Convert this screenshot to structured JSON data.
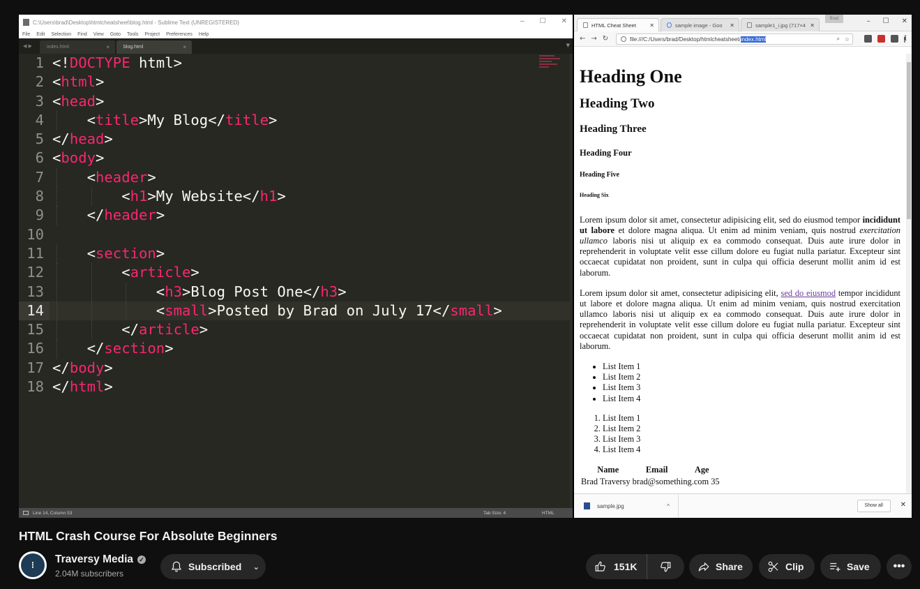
{
  "sublime": {
    "title": "C:\\Users\\brad\\Desktop\\htmlcheatsheet\\blog.html - Sublime Text (UNREGISTERED)",
    "window_controls": [
      "–",
      "☐",
      "✕"
    ],
    "menu": [
      "File",
      "Edit",
      "Selection",
      "Find",
      "View",
      "Goto",
      "Tools",
      "Project",
      "Preferences",
      "Help"
    ],
    "tabs": [
      {
        "label": "index.html",
        "active": false
      },
      {
        "label": "blog.html",
        "active": true
      }
    ],
    "code_lines": [
      {
        "n": "1",
        "segs": [
          [
            "t",
            "<!"
          ],
          [
            "g",
            "DOCTYPE"
          ],
          [
            "t",
            " html>"
          ]
        ]
      },
      {
        "n": "2",
        "segs": [
          [
            "t",
            "<"
          ],
          [
            "g",
            "html"
          ],
          [
            "t",
            ">"
          ]
        ]
      },
      {
        "n": "3",
        "segs": [
          [
            "t",
            "<"
          ],
          [
            "g",
            "head"
          ],
          [
            "t",
            ">"
          ]
        ]
      },
      {
        "n": "4",
        "segs": [
          [
            "t",
            "    <"
          ],
          [
            "g",
            "title"
          ],
          [
            "t",
            ">My Blog</"
          ],
          [
            "g",
            "title"
          ],
          [
            "t",
            ">"
          ]
        ]
      },
      {
        "n": "5",
        "segs": [
          [
            "t",
            "</"
          ],
          [
            "g",
            "head"
          ],
          [
            "t",
            ">"
          ]
        ]
      },
      {
        "n": "6",
        "segs": [
          [
            "t",
            "<"
          ],
          [
            "g",
            "body"
          ],
          [
            "t",
            ">"
          ]
        ]
      },
      {
        "n": "7",
        "segs": [
          [
            "t",
            "    <"
          ],
          [
            "g",
            "header"
          ],
          [
            "t",
            ">"
          ]
        ]
      },
      {
        "n": "8",
        "segs": [
          [
            "t",
            "        <"
          ],
          [
            "g",
            "h1"
          ],
          [
            "t",
            ">My Website</"
          ],
          [
            "g",
            "h1"
          ],
          [
            "t",
            ">"
          ]
        ]
      },
      {
        "n": "9",
        "segs": [
          [
            "t",
            "    </"
          ],
          [
            "g",
            "header"
          ],
          [
            "t",
            ">"
          ]
        ]
      },
      {
        "n": "10",
        "segs": []
      },
      {
        "n": "11",
        "segs": [
          [
            "t",
            "    <"
          ],
          [
            "g",
            "section"
          ],
          [
            "t",
            ">"
          ]
        ]
      },
      {
        "n": "12",
        "segs": [
          [
            "t",
            "        <"
          ],
          [
            "g",
            "article"
          ],
          [
            "t",
            ">"
          ]
        ]
      },
      {
        "n": "13",
        "segs": [
          [
            "t",
            "            <"
          ],
          [
            "g",
            "h3"
          ],
          [
            "t",
            ">Blog Post One</"
          ],
          [
            "g",
            "h3"
          ],
          [
            "t",
            ">"
          ]
        ]
      },
      {
        "n": "14",
        "segs": [
          [
            "t",
            "            <"
          ],
          [
            "g",
            "small"
          ],
          [
            "t",
            ">Posted by Brad on July 17</"
          ],
          [
            "g",
            "small"
          ],
          [
            "t",
            ">"
          ]
        ],
        "current": true
      },
      {
        "n": "15",
        "segs": [
          [
            "t",
            "        </"
          ],
          [
            "g",
            "article"
          ],
          [
            "t",
            ">"
          ]
        ]
      },
      {
        "n": "16",
        "segs": [
          [
            "t",
            "    </"
          ],
          [
            "g",
            "section"
          ],
          [
            "t",
            ">"
          ]
        ]
      },
      {
        "n": "17",
        "segs": [
          [
            "t",
            "</"
          ],
          [
            "g",
            "body"
          ],
          [
            "t",
            ">"
          ]
        ]
      },
      {
        "n": "18",
        "segs": [
          [
            "t",
            "</"
          ],
          [
            "g",
            "html"
          ],
          [
            "t",
            ">"
          ]
        ]
      }
    ],
    "status": {
      "position": "Line 14, Column 53",
      "tab_size": "Tab Size: 4",
      "syntax": "HTML"
    }
  },
  "chrome": {
    "profile_badge": "Brad",
    "tabs": [
      {
        "label": "HTML Cheat Sheet",
        "active": true
      },
      {
        "label": "sample image - Goo",
        "active": false
      },
      {
        "label": "sample1_i.jpg (717×4",
        "active": false
      }
    ],
    "url_prefix": "file:///C:/Users/brad/Desktop/htmlcheatsheet/",
    "url_selected": "index.html",
    "page": {
      "h1": "Heading One",
      "h2": "Heading Two",
      "h3": "Heading Three",
      "h4": "Heading Four",
      "h5": "Heading Five",
      "h6": "Heading Six",
      "p1_a": "Lorem ipsum dolor sit amet, consectetur adipisicing elit, sed do eiusmod tempor ",
      "p1_bold": "incididunt ut labore",
      "p1_b": " et dolore magna aliqua. Ut enim ad minim veniam, quis nostrud ",
      "p1_italic": "exercitation ullamco",
      "p1_c": " laboris nisi ut aliquip ex ea commodo consequat. Duis aute irure dolor in reprehenderit in voluptate velit esse cillum dolore eu fugiat nulla pariatur. Excepteur sint occaecat cupidatat non proident, sunt in culpa qui officia deserunt mollit anim id est laborum.",
      "p2_a": "Lorem ipsum dolor sit amet, consectetur adipisicing elit, ",
      "p2_link": "sed do eiusmod",
      "p2_b": " tempor incididunt ut labore et dolore magna aliqua. Ut enim ad minim veniam, quis nostrud exercitation ullamco laboris nisi ut aliquip ex ea commodo consequat. Duis aute irure dolor in reprehenderit in voluptate velit esse cillum dolore eu fugiat nulla pariatur. Excepteur sint occaecat cupidatat non proident, sunt in culpa qui officia deserunt mollit anim id est laborum.",
      "ul_items": [
        "List Item 1",
        "List Item 2",
        "List Item 3",
        "List Item 4"
      ],
      "ol_items": [
        "List Item 1",
        "List Item 2",
        "List Item 3",
        "List Item 4"
      ],
      "table_headers": [
        "Name",
        "Email",
        "Age"
      ],
      "table_row": "Brad Traversy brad@something.com 35"
    },
    "download_file": "sample.jpg",
    "show_all": "Show all"
  },
  "youtube": {
    "video_title": "HTML Crash Course For Absolute Beginners",
    "channel_name": "Traversy Media",
    "subscribers": "2.04M subscribers",
    "subscribed_label": "Subscribed",
    "likes": "151K",
    "share_label": "Share",
    "clip_label": "Clip",
    "save_label": "Save"
  },
  "colors": {
    "tag": "#f92672",
    "editor_bg": "#272822",
    "page_bg": "#0f0f0f",
    "pill_bg": "#272727"
  }
}
